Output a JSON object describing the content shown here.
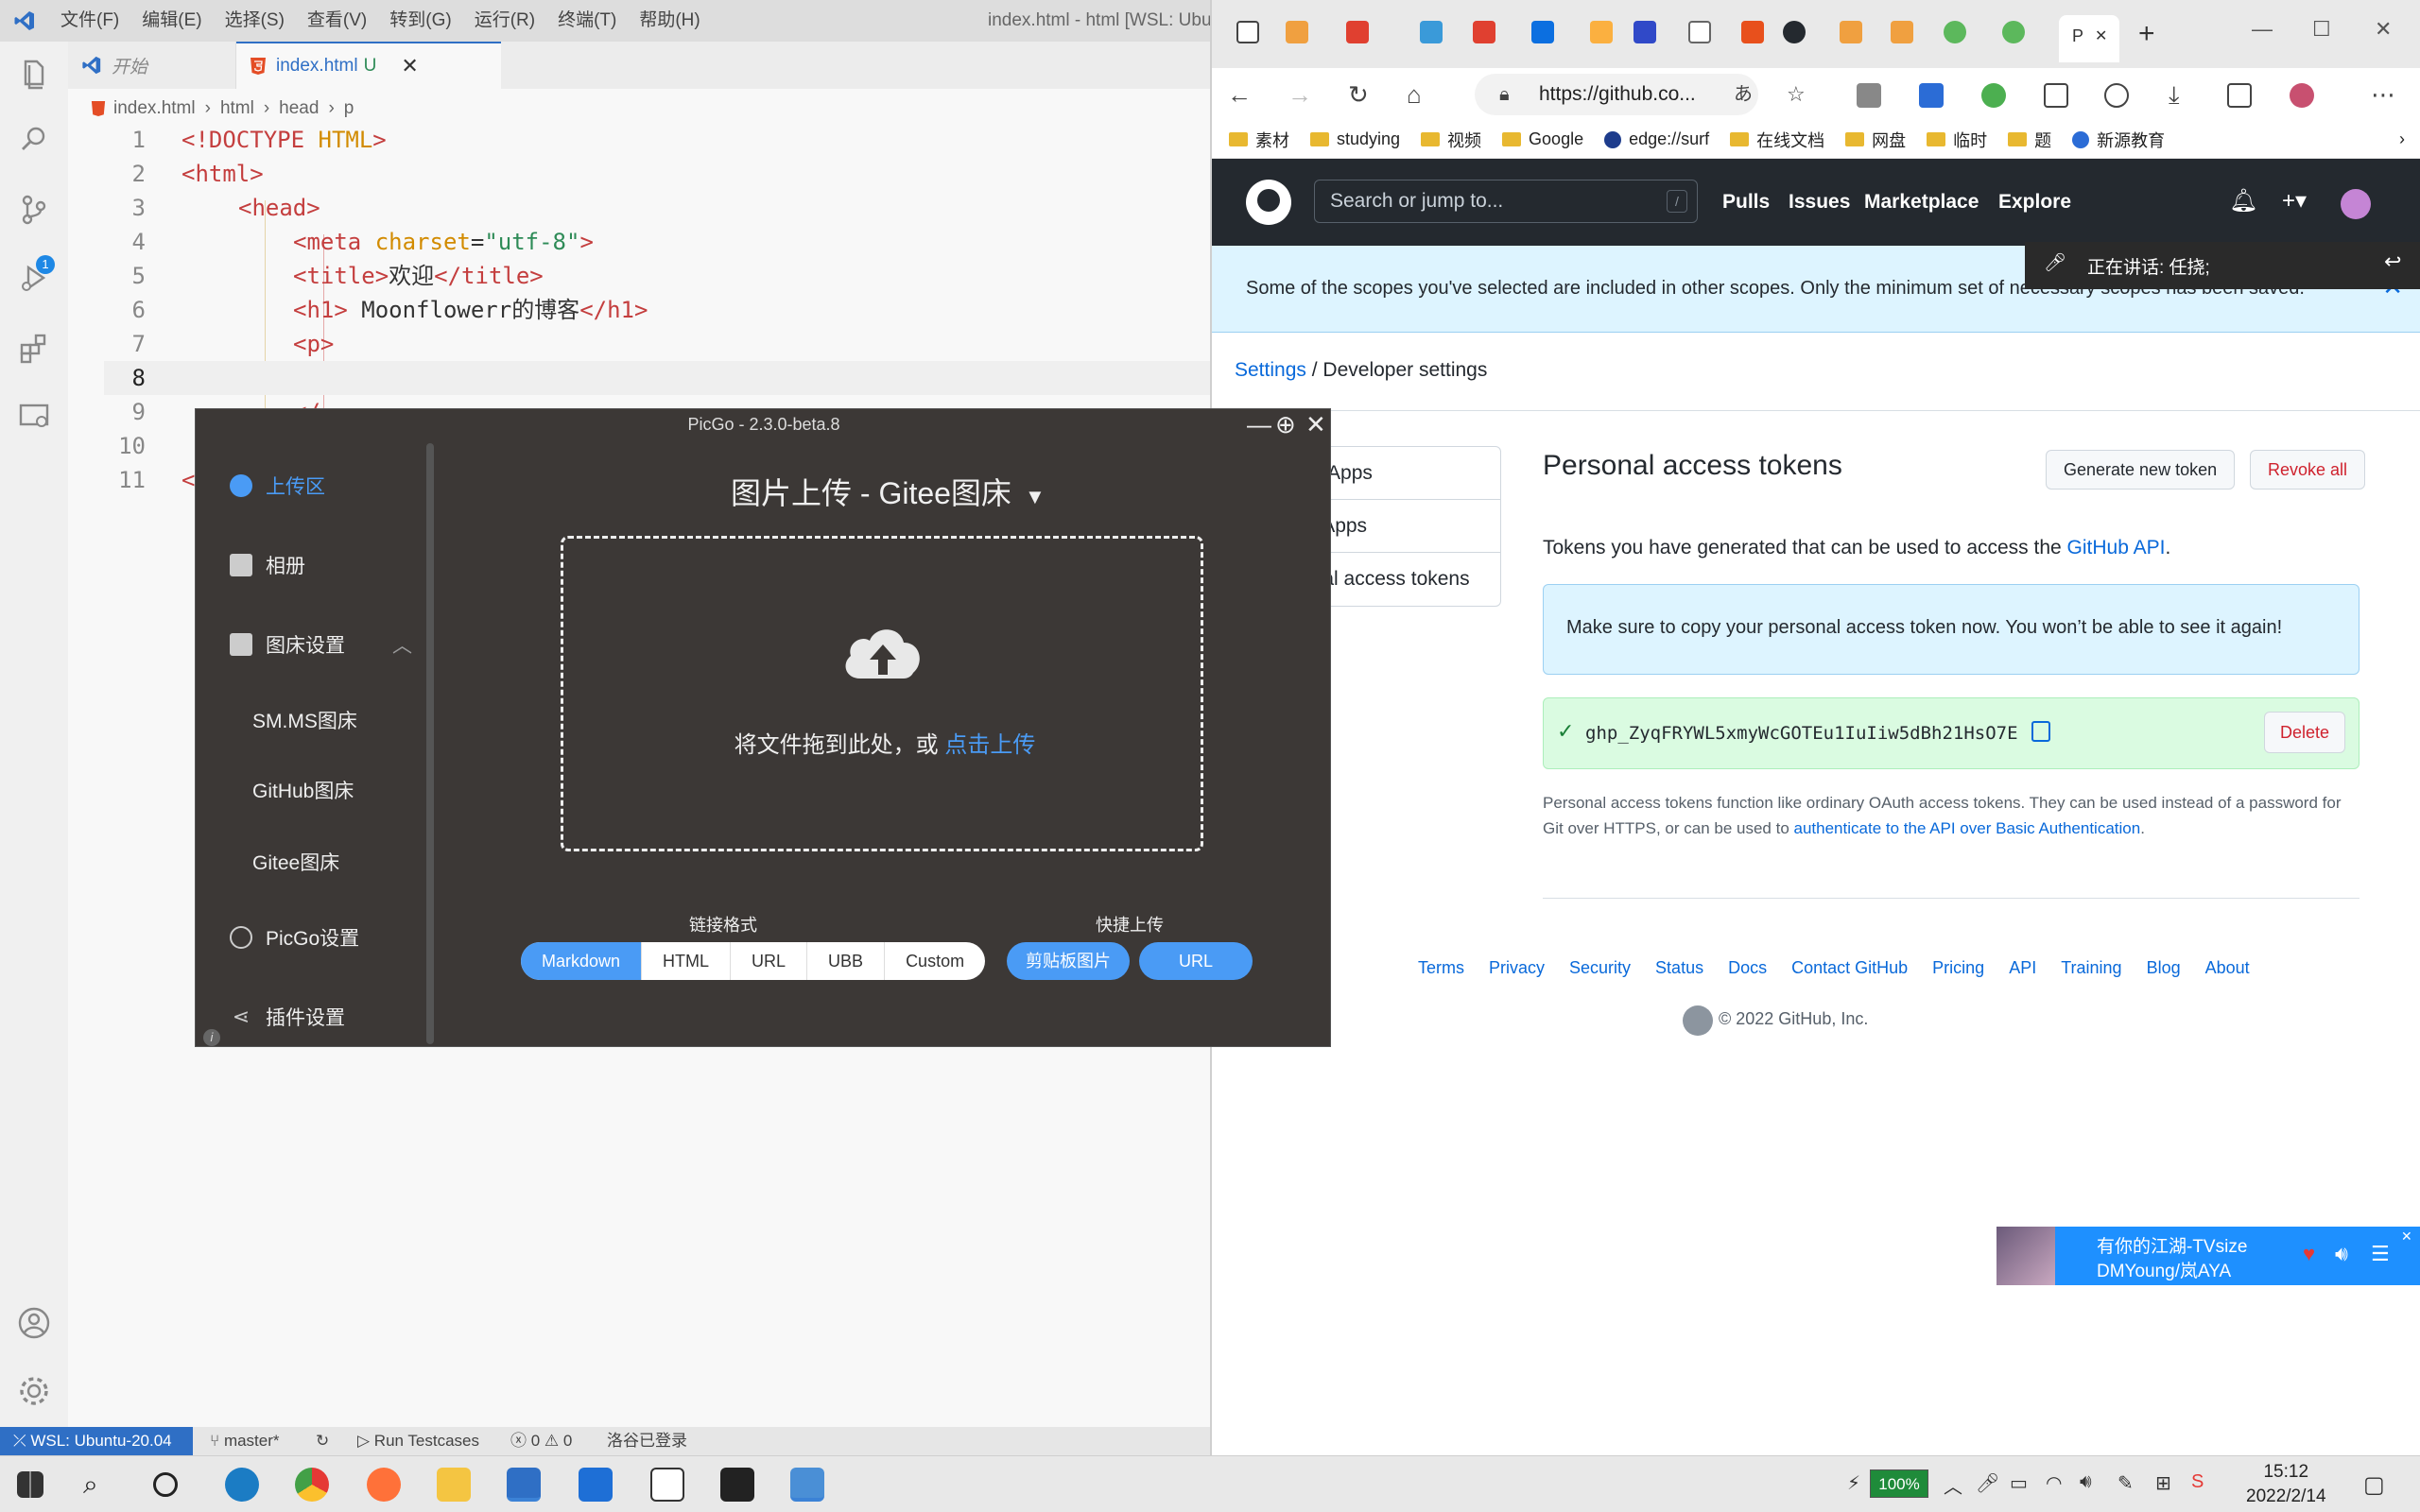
{
  "vscode": {
    "menu": [
      "文件(F)",
      "编辑(E)",
      "选择(S)",
      "查看(V)",
      "转到(G)",
      "运行(R)",
      "终端(T)",
      "帮助(H)"
    ],
    "window_title": "index.html - html [WSL: Ubuntu",
    "tabs": [
      {
        "label": "开始"
      },
      {
        "label": "index.html",
        "status": "U"
      }
    ],
    "breadcrumb": [
      "index.html",
      "html",
      "head",
      "p"
    ],
    "lines": [
      {
        "n": "1"
      },
      {
        "n": "2"
      },
      {
        "n": "3"
      },
      {
        "n": "4"
      },
      {
        "n": "5"
      },
      {
        "n": "6"
      },
      {
        "n": "7"
      },
      {
        "n": "8"
      },
      {
        "n": "9"
      },
      {
        "n": "10"
      },
      {
        "n": "11"
      }
    ],
    "code": {
      "l1_a": "<!DOCTYPE ",
      "l1_b": "HTML",
      "l1_c": ">",
      "l2": "<html>",
      "l3": "<head>",
      "l4_a": "<meta ",
      "l4_b": "charset",
      "l4_c": "=",
      "l4_d": "\"utf-8\"",
      "l4_e": ">",
      "l5_a": "<title>",
      "l5_b": "欢迎",
      "l5_c": "</title>",
      "l6_a": "<h1>",
      "l6_b": " Moonflowerr的博客",
      "l6_c": "</h1>",
      "l7": "<p>",
      "l9": "</",
      "l11": "<"
    },
    "activity_badge": "1",
    "status": {
      "remote": "WSL: Ubuntu-20.04",
      "branch": "master*",
      "run": "Run Testcases",
      "errors": "0",
      "warnings": "0",
      "login": "洛谷已登录"
    }
  },
  "browser": {
    "active_tab": "P",
    "url": "https://github.co...",
    "favorites": [
      "素材",
      "studying",
      "视频",
      "Google",
      "edge://surf",
      "在线文档",
      "网盘",
      "临时",
      "题",
      "新源教育"
    ],
    "github": {
      "search_placeholder": "Search or jump to...",
      "search_key": "/",
      "nav": [
        "Pulls",
        "Issues",
        "Marketplace",
        "Explore"
      ],
      "flash": "Some of the scopes you've selected are included in other scopes. Only the minimum set of necessary scopes has been saved.",
      "speaking": "正在讲话: 任挠;",
      "breadcrumb_settings": "Settings",
      "breadcrumb_sep": "/",
      "breadcrumb_current": "Developer settings",
      "sidenav": [
        "ub Apps",
        "th Apps",
        "onal access tokens"
      ],
      "page_title": "Personal access tokens",
      "generate_btn": "Generate new token",
      "revoke_btn": "Revoke all",
      "desc_text": "Tokens you have generated that can be used to access the ",
      "desc_link": "GitHub API",
      "desc_end": ".",
      "note": "Make sure to copy your personal access token now. You won’t be able to see it again!",
      "token": "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",
      "delete_btn": "Delete",
      "foot_text": "Personal access tokens function like ordinary OAuth access tokens. They can be used instead of a password for Git over HTTPS, or can be used to ",
      "foot_link": "authenticate to the API over Basic Authentication",
      "foot_end": ".",
      "footer_links": [
        "Terms",
        "Privacy",
        "Security",
        "Status",
        "Docs",
        "Contact GitHub",
        "Pricing",
        "API",
        "Training",
        "Blog",
        "About"
      ],
      "copyright": "© 2022 GitHub, Inc."
    },
    "music": {
      "title": "有你的江湖-TVsize",
      "artist": "DMYoung/岚AYA"
    }
  },
  "picgo": {
    "window_title": "PicGo - 2.3.0-beta.8",
    "nav": {
      "upload": "上传区",
      "album": "相册",
      "bed_settings": "图床设置",
      "smms": "SM.MS图床",
      "github": "GitHub图床",
      "gitee": "Gitee图床",
      "picgo_settings": "PicGo设置",
      "plugins": "插件设置"
    },
    "main_title": "图片上传 - Gitee图床",
    "drop_text": "将文件拖到此处，或 ",
    "drop_link": "点击上传",
    "link_format_label": "链接格式",
    "formats": [
      "Markdown",
      "HTML",
      "URL",
      "UBB",
      "Custom"
    ],
    "selected_format": "Markdown",
    "quick_upload_label": "快捷上传",
    "clipboard_btn": "剪贴板图片",
    "url_btn": "URL"
  },
  "taskbar": {
    "battery": "100%",
    "time": "15:12",
    "date": "2022/2/14"
  },
  "colors": {
    "accent_blue": "#2f6fc5",
    "github_dark": "#24292f",
    "picgo_bg": "#3c3836",
    "picgo_blue": "#4a9bf5",
    "token_green": "#dafbe1",
    "danger_red": "#cf222e"
  }
}
